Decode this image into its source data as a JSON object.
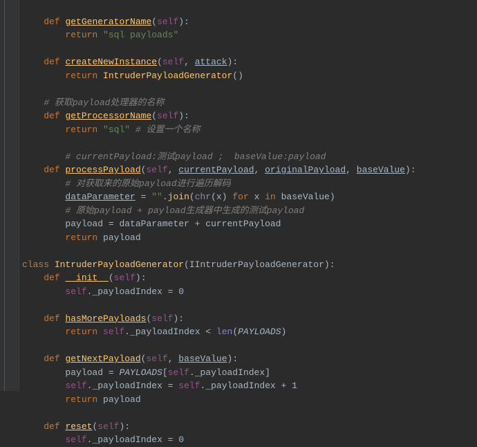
{
  "code": {
    "kw_def": "def",
    "kw_return": "return",
    "kw_class": "class",
    "kw_for": "for",
    "kw_in": "in",
    "self": "self",
    "attack": "attack",
    "methods": {
      "getGeneratorName": "getGeneratorName",
      "createNewInstance": "createNewInstance",
      "getProcessorName": "getProcessorName",
      "processPayload": "processPayload",
      "init": "__init__",
      "hasMorePayloads": "hasMorePayloads",
      "getNextPayload": "getNextPayload",
      "reset": "reset"
    },
    "class_name": "IntruderPayloadGenerator",
    "base_class": "IIntruderPayloadGenerator",
    "strings": {
      "sql_payloads": "\"sql payloads\"",
      "sql": "\"sql\"",
      "empty": "\"\""
    },
    "comments": {
      "get_processor": "# 获取payload处理器的名称",
      "set_name": "# 设置一个名称",
      "current_base": "# currentPayload:测试payload ;  baseValue:payload",
      "decode": "# 对获取来的原始payload进行遍历解码",
      "orig_plus": "# 原始payload + payload生成器中生成的测试payload"
    },
    "params": {
      "currentPayload": "currentPayload",
      "originalPayload": "originalPayload",
      "baseValue": "baseValue"
    },
    "builtins": {
      "join": "join",
      "chr": "chr",
      "len": "len"
    },
    "vars": {
      "dataParameter": "dataParameter",
      "payload": "payload",
      "x": "x",
      "payloadIndex": "_payloadIndex",
      "PAYLOADS": "PAYLOADS"
    },
    "nums": {
      "zero": "0",
      "one": "1"
    },
    "ops": {
      "eq": " = ",
      "plus": " + ",
      "lt": " < "
    }
  },
  "watermark": ""
}
